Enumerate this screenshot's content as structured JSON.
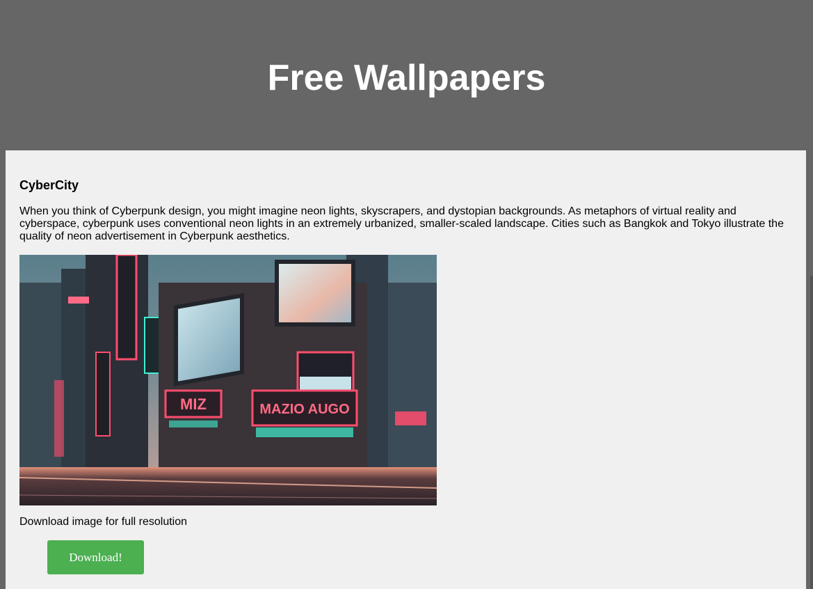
{
  "header": {
    "title": "Free Wallpapers"
  },
  "wallpaper": {
    "title": "CyberCity",
    "description": "When you think of Cyberpunk design, you might imagine neon lights, skyscrapers, and dystopian backgrounds. As metaphors of virtual reality and cyberspace, cyberpunk uses conventional neon lights in an extremely urbanized, smaller-scaled landscape. Cities such as Bangkok and Tokyo illustrate the quality of neon advertisement in Cyberpunk aesthetics.",
    "image_sign_left": "MIZ",
    "image_sign_right": "MAZIO AUGO",
    "download_hint": "Download image for full resolution",
    "download_label": "Download!"
  },
  "colors": {
    "header_bg": "#666666",
    "card_bg": "#f0f0f0",
    "button_bg": "#4caf50",
    "neon_pink": "#ff4d6d",
    "neon_cyan": "#3ff0d0"
  }
}
